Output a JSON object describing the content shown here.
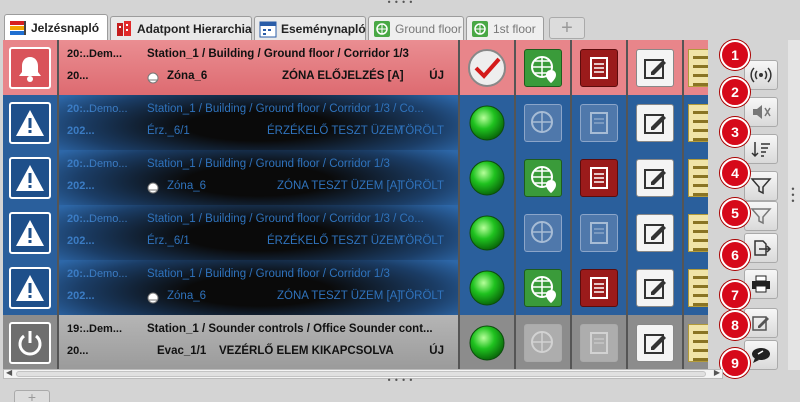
{
  "tabs": [
    {
      "label": "Jelzésnapló",
      "icon": "event-log-icon"
    },
    {
      "label": "Adatpont Hierarchia",
      "icon": "hierarchy-icon"
    },
    {
      "label": "Eseménynapló",
      "icon": "calendar-log-icon"
    },
    {
      "label": "Ground floor",
      "icon": "floor-plan-icon"
    },
    {
      "label": "1st floor",
      "icon": "floor-plan-icon"
    }
  ],
  "tab_add_label": "+",
  "top_grip": "• • • •",
  "bottom_grip": "• • • •",
  "rows": [
    {
      "kind": "alarm",
      "type_icon": "bell-icon",
      "date1": "20:...",
      "date2": "20...",
      "source": "Dem...",
      "path": "Station_1 / Building / Ground floor / Corridor 1/3",
      "device": "Zóna_6",
      "message": "ZÓNA ELŐJELZÉS [A]",
      "status": "ÚJ",
      "ack": "checkmark"
    },
    {
      "kind": "blue",
      "type_icon": "warning-icon",
      "date1": "20:...",
      "date2": "202...",
      "source": "Demo...",
      "path": "Station_1 / Building / Ground floor / Corridor 1/3 / Co...",
      "device": "Érz._6/1",
      "message": "ÉRZÉKELŐ TESZT ÜZEM",
      "status": "TÖRÖLT",
      "ack": "green-led"
    },
    {
      "kind": "blue",
      "type_icon": "warning-icon",
      "date1": "20:...",
      "date2": "202...",
      "source": "Demo...",
      "path": "Station_1 / Building / Ground floor / Corridor 1/3",
      "device": "Zóna_6",
      "message": "ZÓNA TESZT ÜZEM [A]",
      "status": "TÖRÖLT",
      "ack": "green-led"
    },
    {
      "kind": "blue",
      "type_icon": "warning-icon",
      "date1": "20:...",
      "date2": "202...",
      "source": "Demo...",
      "path": "Station_1 / Building / Ground floor / Corridor 1/3 / Co...",
      "device": "Érz._6/1",
      "message": "ÉRZÉKELŐ TESZT ÜZEM",
      "status": "TÖRÖLT",
      "ack": "green-led"
    },
    {
      "kind": "blue",
      "type_icon": "warning-icon",
      "date1": "20:...",
      "date2": "202...",
      "source": "Demo...",
      "path": "Station_1 / Building / Ground floor / Corridor 1/3",
      "device": "Zóna_6",
      "message": "ZÓNA TESZT ÜZEM [A]",
      "status": "TÖRÖLT",
      "ack": "green-led"
    },
    {
      "kind": "gray",
      "type_icon": "power-icon",
      "date1": "19:...",
      "date2": "20...",
      "source": "Dem...",
      "path": "Station_1 / Sounder controls / Office Sounder cont...",
      "device": "Evac_1/1",
      "message": "VEZÉRLŐ ELEM KIKAPCSOLVA",
      "status": "ÚJ",
      "ack": "green-led"
    }
  ],
  "side_buttons": [
    {
      "badge": "1",
      "icon": "broadcast-icon"
    },
    {
      "badge": "2",
      "icon": "mute-sound-icon"
    },
    {
      "badge": "3",
      "icon": "sort-icon"
    },
    {
      "badge": "4",
      "icon": "filter-icon"
    },
    {
      "badge": "5",
      "icon": "filter-clear-icon"
    },
    {
      "badge": "6",
      "icon": "export-icon"
    },
    {
      "badge": "7",
      "icon": "print-icon"
    },
    {
      "badge": "8",
      "icon": "edit-icon"
    },
    {
      "badge": "9",
      "icon": "comment-icon"
    }
  ],
  "colors": {
    "alarm_row": "#e8858a",
    "fault_row": "#2a5f9c",
    "off_row": "#8c8c8c",
    "badge": "#d6091a",
    "geo_button": "#3a9b3a",
    "doc_button": "#9b1b1b"
  }
}
